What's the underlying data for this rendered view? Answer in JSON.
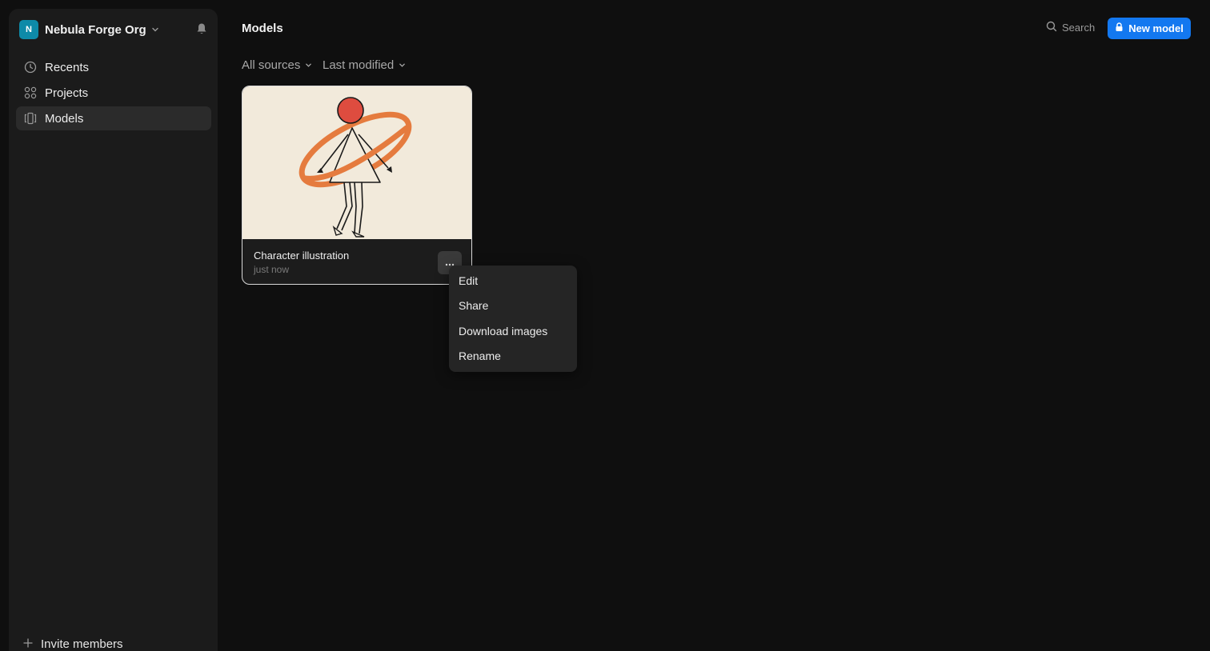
{
  "org": {
    "initial": "N",
    "name": "Nebula Forge Org",
    "avatar_color": "#0e8aa8"
  },
  "sidebar": {
    "items": [
      {
        "label": "Recents",
        "icon": "clock-icon"
      },
      {
        "label": "Projects",
        "icon": "grid-icon"
      },
      {
        "label": "Models",
        "icon": "model-icon",
        "active": true
      }
    ],
    "invite_label": "Invite members"
  },
  "header": {
    "title": "Models",
    "search_label": "Search",
    "new_model_label": "New model",
    "accent": "#1378f0"
  },
  "filters": {
    "source": "All sources",
    "sort": "Last modified"
  },
  "cards": [
    {
      "title": "Character illustration",
      "time": "just now"
    }
  ],
  "menu": {
    "items": [
      "Edit",
      "Share",
      "Download images",
      "Rename"
    ]
  }
}
